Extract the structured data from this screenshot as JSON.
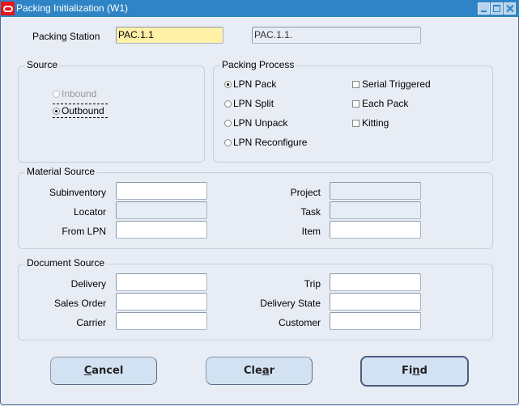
{
  "window": {
    "title": "Packing Initialization (W1)",
    "controls": [
      "minimize",
      "maximize",
      "close"
    ]
  },
  "header": {
    "packing_station_label": "Packing Station",
    "packing_station_value": "PAC.1.1",
    "packing_station_desc": "PAC.1.1."
  },
  "source": {
    "title": "Source",
    "options": [
      {
        "label": "Inbound",
        "checked": false,
        "enabled": false
      },
      {
        "label": "Outbound",
        "checked": true,
        "enabled": true
      }
    ]
  },
  "packing_process": {
    "title": "Packing Process",
    "radios": [
      {
        "label": "LPN Pack",
        "checked": true
      },
      {
        "label": "LPN Split",
        "checked": false
      },
      {
        "label": "LPN Unpack",
        "checked": false
      },
      {
        "label": "LPN Reconfigure",
        "checked": false
      }
    ],
    "checkboxes": [
      {
        "label": "Serial Triggered",
        "checked": false
      },
      {
        "label": "Each Pack",
        "checked": false
      },
      {
        "label": "Kitting",
        "checked": false
      }
    ]
  },
  "material_source": {
    "title": "Material Source",
    "fields": [
      {
        "label": "Subinventory",
        "value": "",
        "enabled": true
      },
      {
        "label": "Locator",
        "value": "",
        "enabled": false
      },
      {
        "label": "From LPN",
        "value": "",
        "enabled": true
      },
      {
        "label": "Project",
        "value": "",
        "enabled": false
      },
      {
        "label": "Task",
        "value": "",
        "enabled": false
      },
      {
        "label": "Item",
        "value": "",
        "enabled": true
      }
    ]
  },
  "document_source": {
    "title": "Document Source",
    "fields": [
      {
        "label": "Delivery",
        "value": ""
      },
      {
        "label": "Sales Order",
        "value": ""
      },
      {
        "label": "Carrier",
        "value": ""
      },
      {
        "label": "Trip",
        "value": ""
      },
      {
        "label": "Delivery State",
        "value": ""
      },
      {
        "label": "Customer",
        "value": ""
      }
    ]
  },
  "buttons": {
    "cancel": {
      "pre": "",
      "mn": "C",
      "post": "ancel"
    },
    "clear": {
      "pre": "Cle",
      "mn": "a",
      "post": "r"
    },
    "find": {
      "pre": "Fi",
      "mn": "n",
      "post": "d"
    }
  }
}
